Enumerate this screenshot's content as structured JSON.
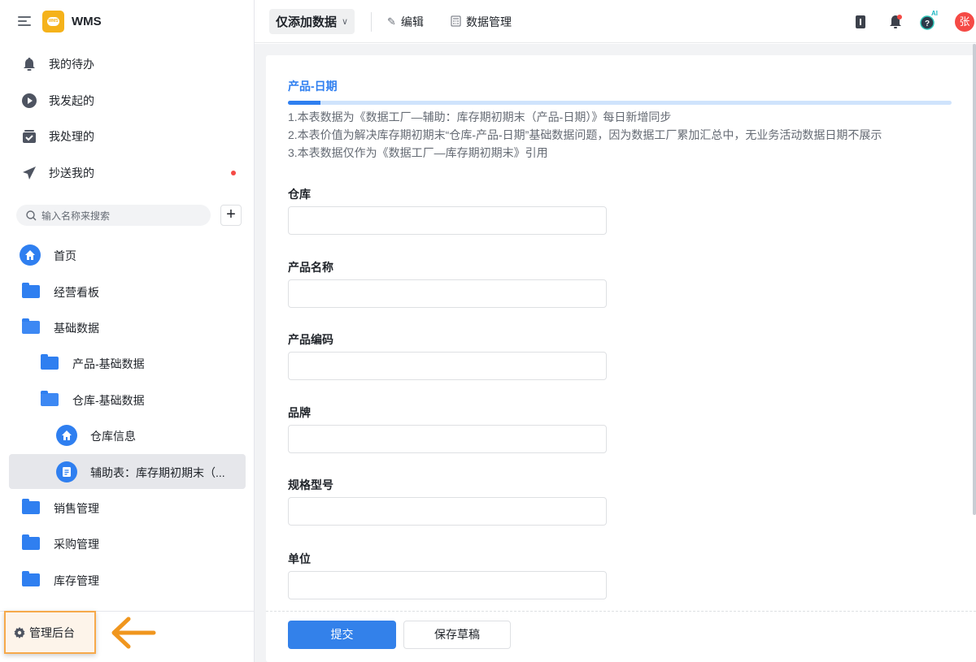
{
  "sidebar": {
    "app_name": "WMS",
    "logo_text": "WMS",
    "quick": [
      {
        "label": "我的待办"
      },
      {
        "label": "我发起的"
      },
      {
        "label": "我处理的"
      },
      {
        "label": "抄送我的"
      }
    ],
    "search_placeholder": "输入名称来搜索",
    "tree": [
      {
        "label": "首页"
      },
      {
        "label": "经营看板"
      },
      {
        "label": "基础数据"
      },
      {
        "label": "产品-基础数据"
      },
      {
        "label": "仓库-基础数据"
      },
      {
        "label": "仓库信息"
      },
      {
        "label": "辅助表：库存期初期末（..."
      },
      {
        "label": "销售管理"
      },
      {
        "label": "采购管理"
      },
      {
        "label": "库存管理"
      }
    ],
    "admin_label": "管理后台"
  },
  "topbar": {
    "mode_label": "仅添加数据",
    "edit_label": "编辑",
    "manage_label": "数据管理",
    "avatar_text": "张",
    "ai_badge": "AI"
  },
  "form": {
    "section_title": "产品-日期",
    "description": [
      "1.本表数据为《数据工厂—辅助：库存期初期末（产品-日期）》每日新增同步",
      "2.本表价值为解决库存期初期末“仓库-产品-日期”基础数据问题，因为数据工厂累加汇总中，无业务活动数据日期不展示",
      "3.本表数据仅作为《数据工厂—库存期初期末》引用"
    ],
    "fields": [
      {
        "label": "仓库",
        "value": ""
      },
      {
        "label": "产品名称",
        "value": ""
      },
      {
        "label": "产品编码",
        "value": ""
      },
      {
        "label": "品牌",
        "value": ""
      },
      {
        "label": "规格型号",
        "value": ""
      },
      {
        "label": "单位",
        "value": ""
      }
    ],
    "submit_label": "提交",
    "draft_label": "保存草稿"
  },
  "colors": {
    "accent": "#2f7ff0",
    "highlight": "#f6a94a",
    "badge": "#f54a45"
  }
}
